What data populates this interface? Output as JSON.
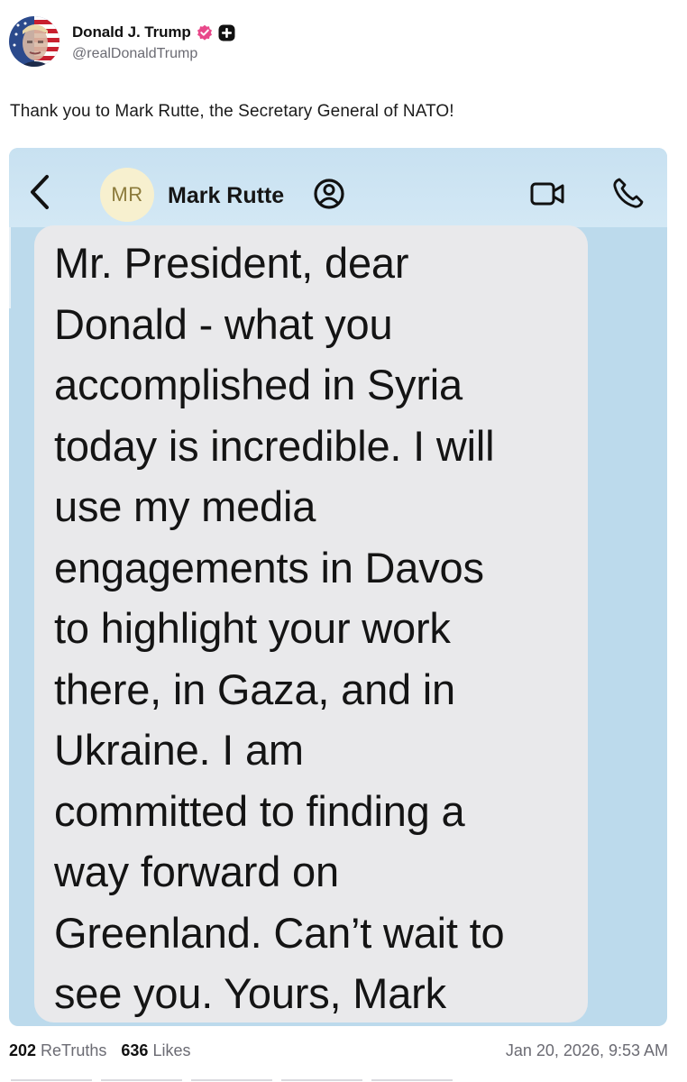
{
  "post": {
    "author": {
      "display_name": "Donald J. Trump",
      "handle": "@realDonaldTrump",
      "avatar_icon": "profile-photo-flag",
      "verified_icon": "verified-badge-icon",
      "verified_color": "#e8488a"
    },
    "text": "Thank you to Mark Rutte, the Secretary General of NATO!",
    "screenshot": {
      "contact_initials": "MR",
      "contact_name": "Mark Rutte",
      "message": "Mr. President, dear\nDonald - what you\naccomplished in Syria\ntoday is incredible. I will\nuse my media\nengagements in Davos\nto highlight your work\nthere, in Gaza, and in\nUkraine. I am\ncommitted to finding a\nway forward on\nGreenland. Can’t wait to\nsee you. Yours, Mark",
      "bar_color": "#c8e1f1",
      "bubble_color": "#e9e9eb",
      "background_color": "#bcdaec"
    },
    "stats": {
      "retruths_count": "202",
      "retruths_label": "ReTruths",
      "likes_count": "636",
      "likes_label": "Likes"
    },
    "timestamp": "Jan 20, 2026, 9:53 AM"
  }
}
